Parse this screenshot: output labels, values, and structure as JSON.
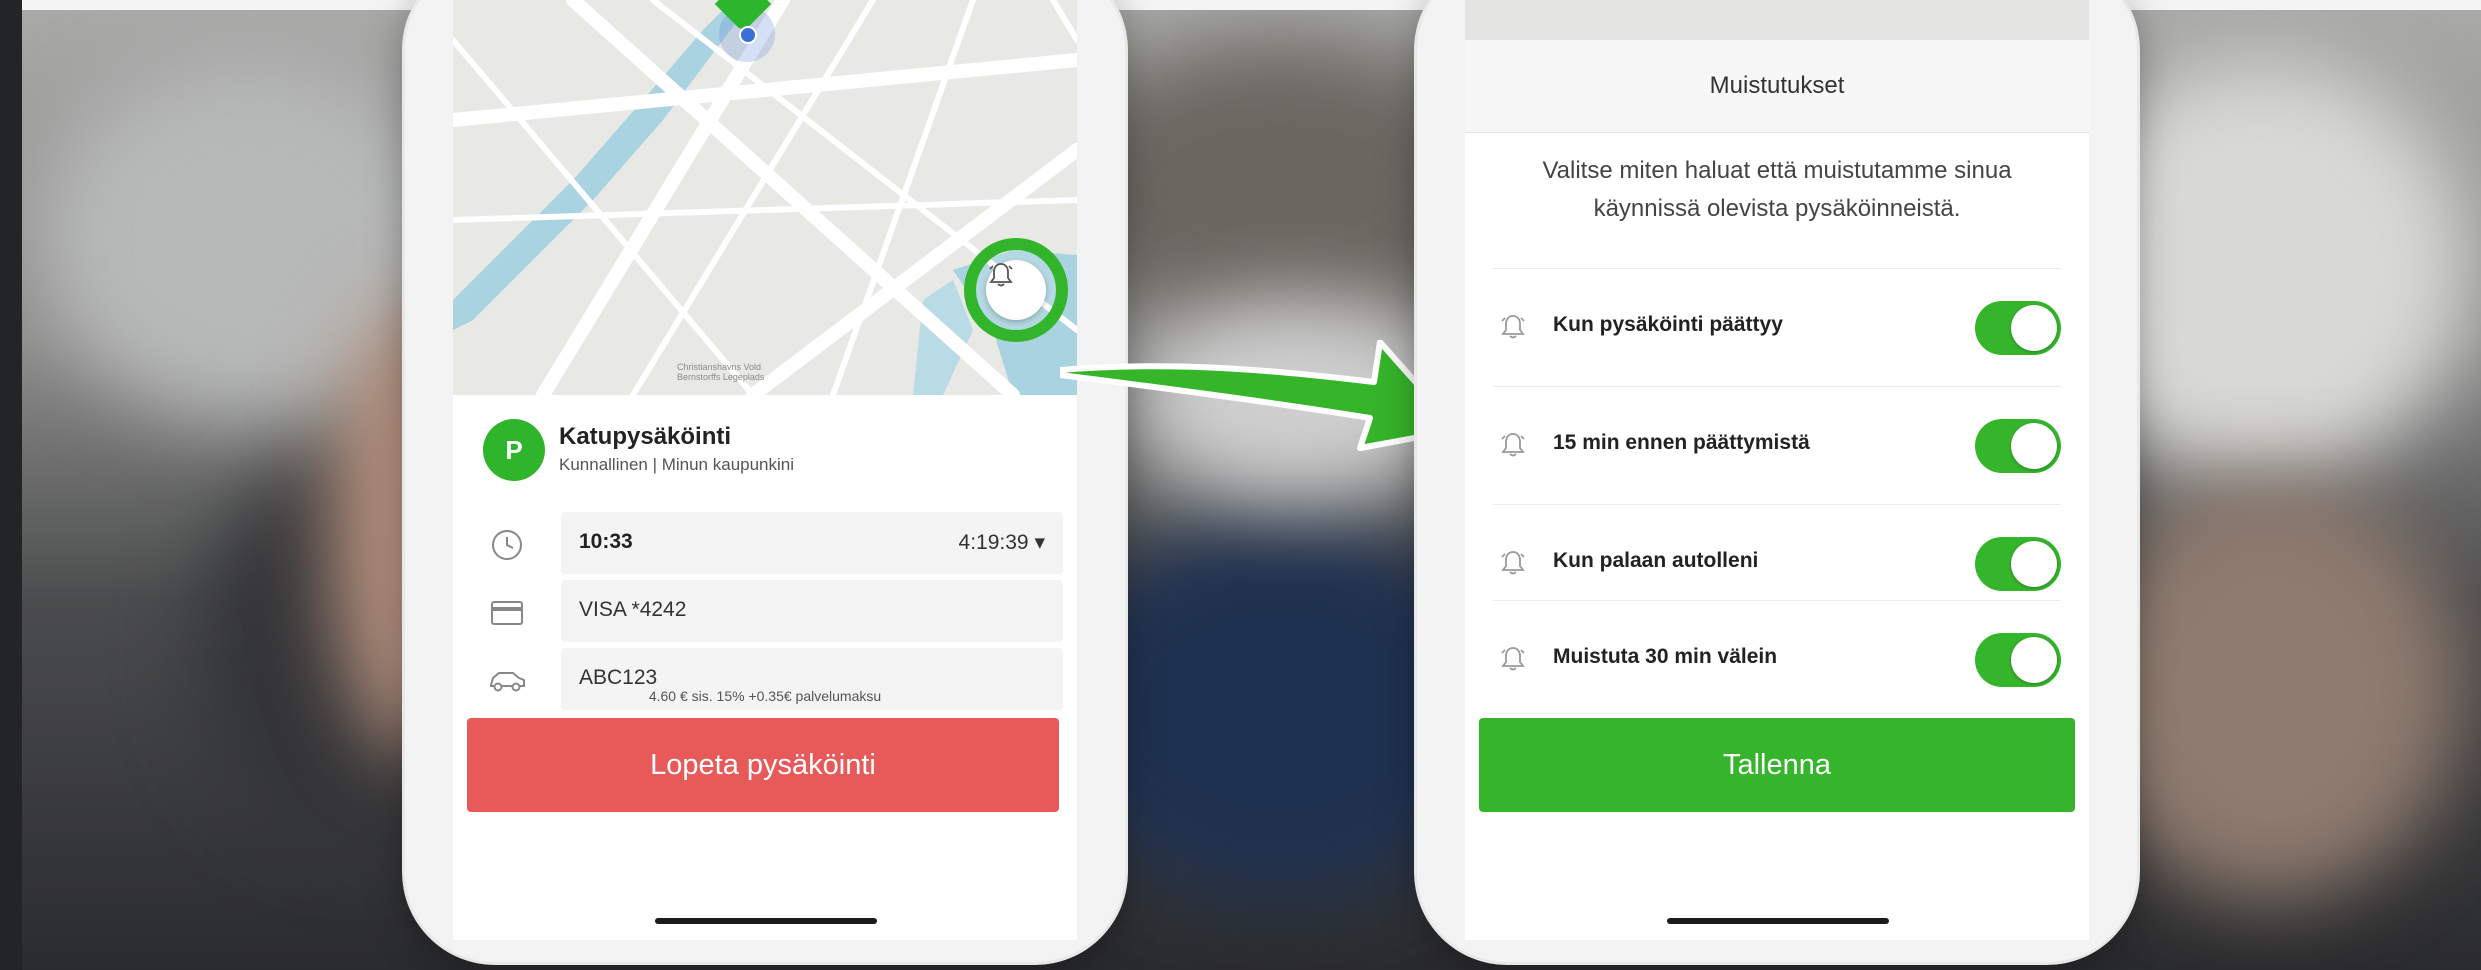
{
  "colors": {
    "accent_green": "#35b52c",
    "stop_red": "#e85a5a",
    "text_dark": "#222222"
  },
  "left_phone": {
    "map": {
      "credit_line1": "Christianshavns Vold",
      "credit_line2": "Bernstorffs Legeplads",
      "pin_icon": "location-pin-icon",
      "alert_icon": "bell-icon"
    },
    "zone": {
      "badge": "P",
      "title": "Katupysäköinti",
      "subtitle": "Kunnallinen | Minun kaupunkini"
    },
    "time": {
      "icon": "clock-icon",
      "start": "10:33",
      "duration": "4:19:39 ▾"
    },
    "payment": {
      "icon": "credit-card-icon",
      "value": "VISA *4242"
    },
    "vehicle": {
      "icon": "car-icon",
      "value": "ABC123"
    },
    "price_note": "4.60 € sis. 15% +0.35€ palvelumaksu",
    "stop_button": "Lopeta pysäköinti"
  },
  "right_phone": {
    "title": "Muistutukset",
    "description": "Valitse miten haluat että muistutamme sinua käynnissä olevista pysäköinneistä.",
    "settings": [
      {
        "label": "Kun pysäköinti päättyy",
        "enabled": true,
        "icon": "bell-icon"
      },
      {
        "label": "15 min ennen päättymistä",
        "enabled": true,
        "icon": "bell-icon"
      },
      {
        "label": "Kun palaan autolleni",
        "enabled": true,
        "icon": "bell-icon"
      },
      {
        "label": "Muistuta 30 min välein",
        "enabled": true,
        "icon": "bell-icon"
      }
    ],
    "save_button": "Tallenna"
  }
}
